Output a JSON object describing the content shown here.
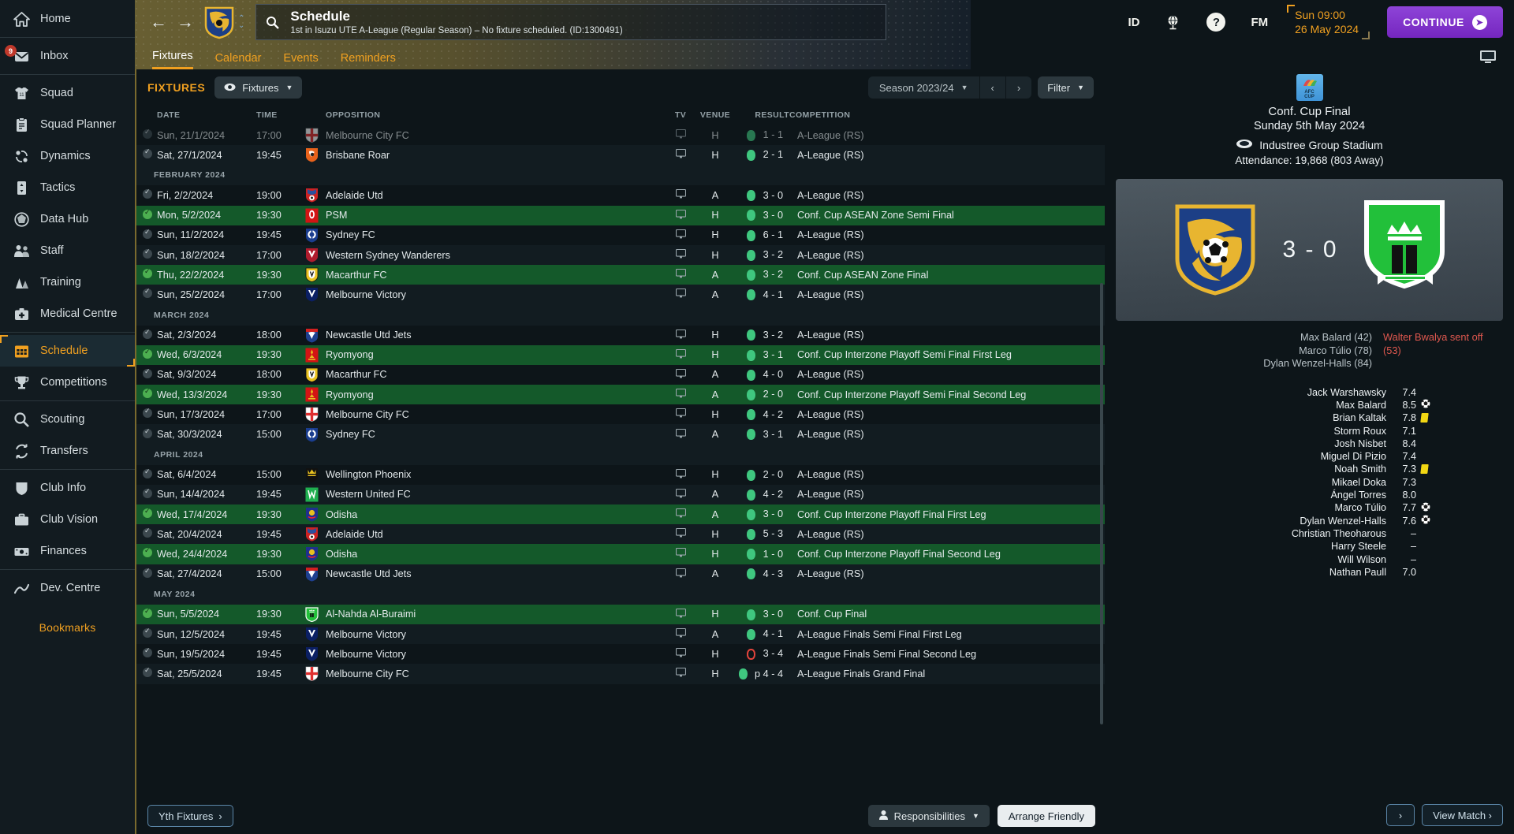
{
  "sidebar": {
    "items": [
      {
        "label": "Home",
        "icon": "home-icon"
      },
      {
        "label": "Inbox",
        "icon": "inbox-icon",
        "badge": "9"
      },
      {
        "label": "Squad",
        "icon": "shirt-icon"
      },
      {
        "label": "Squad Planner",
        "icon": "clipboard-icon"
      },
      {
        "label": "Dynamics",
        "icon": "dynamics-icon"
      },
      {
        "label": "Tactics",
        "icon": "tactics-icon"
      },
      {
        "label": "Data Hub",
        "icon": "data-hub-icon"
      },
      {
        "label": "Staff",
        "icon": "staff-icon"
      },
      {
        "label": "Training",
        "icon": "training-icon"
      },
      {
        "label": "Medical Centre",
        "icon": "medical-icon"
      },
      {
        "label": "Schedule",
        "icon": "calendar-icon",
        "active": true
      },
      {
        "label": "Competitions",
        "icon": "trophy-icon"
      },
      {
        "label": "Scouting",
        "icon": "magnifier-icon"
      },
      {
        "label": "Transfers",
        "icon": "transfer-icon"
      },
      {
        "label": "Club Info",
        "icon": "shield-icon"
      },
      {
        "label": "Club Vision",
        "icon": "briefcase-icon"
      },
      {
        "label": "Finances",
        "icon": "money-icon"
      },
      {
        "label": "Dev. Centre",
        "icon": "dev-centre-icon"
      }
    ],
    "bookmarks_label": "Bookmarks"
  },
  "header": {
    "title": "Schedule",
    "subtitle": "1st in Isuzu UTE A-League (Regular Season) – No fixture scheduled. (ID:1300491)",
    "back_icon": "back-arrow-icon",
    "forward_icon": "forward-arrow-icon",
    "search_icon": "search-icon",
    "icons": [
      "ID",
      "globe-icon",
      "help-icon",
      "FM"
    ],
    "game_time": "Sun 09:00",
    "game_date": "26 May 2024",
    "continue_label": "CONTINUE",
    "tabs": [
      {
        "label": "Fixtures",
        "selected": true
      },
      {
        "label": "Calendar",
        "selected": false
      },
      {
        "label": "Events",
        "selected": false
      },
      {
        "label": "Reminders",
        "selected": false
      }
    ]
  },
  "toolbar": {
    "section_title": "FIXTURES",
    "view_pill": "Fixtures",
    "season": "Season 2023/24",
    "prev": "‹",
    "next": "›",
    "filter": "Filter"
  },
  "table": {
    "columns": [
      "DATE",
      "TIME",
      "OPPOSITION",
      "TV",
      "VENUE",
      "RESULT",
      "COMPETITION"
    ],
    "rows": [
      {
        "type": "fixture",
        "partial": true,
        "checked": true,
        "date": "Sun, 21/1/2024",
        "time": "17:00",
        "opponent": "Melbourne City FC",
        "crest": "mcity",
        "tv": true,
        "venue": "H",
        "result": "1 - 1",
        "outcome": "w",
        "competition": "A-League (RS)",
        "highlight": false
      },
      {
        "type": "fixture",
        "checked": true,
        "date": "Sat, 27/1/2024",
        "time": "19:45",
        "opponent": "Brisbane Roar",
        "crest": "brisbane",
        "tv": true,
        "venue": "H",
        "result": "2 - 1",
        "outcome": "w",
        "competition": "A-League (RS)",
        "highlight": false
      },
      {
        "type": "month",
        "label": "FEBRUARY 2024"
      },
      {
        "type": "fixture",
        "checked": true,
        "date": "Fri, 2/2/2024",
        "time": "19:00",
        "opponent": "Adelaide Utd",
        "crest": "adelaide",
        "tv": true,
        "venue": "A",
        "result": "3 - 0",
        "outcome": "w",
        "competition": "A-League (RS)",
        "highlight": false
      },
      {
        "type": "fixture",
        "checked": true,
        "date": "Mon, 5/2/2024",
        "time": "19:30",
        "opponent": "PSM",
        "crest": "psm",
        "tv": true,
        "venue": "H",
        "result": "3 - 0",
        "outcome": "w",
        "competition": "Conf. Cup ASEAN Zone Semi Final",
        "highlight": true
      },
      {
        "type": "fixture",
        "checked": true,
        "date": "Sun, 11/2/2024",
        "time": "19:45",
        "opponent": "Sydney FC",
        "crest": "sydney",
        "tv": true,
        "venue": "H",
        "result": "6 - 1",
        "outcome": "w",
        "competition": "A-League (RS)",
        "highlight": false
      },
      {
        "type": "fixture",
        "checked": true,
        "date": "Sun, 18/2/2024",
        "time": "17:00",
        "opponent": "Western Sydney Wanderers",
        "crest": "wsw",
        "tv": true,
        "venue": "H",
        "result": "3 - 2",
        "outcome": "w",
        "competition": "A-League (RS)",
        "highlight": false
      },
      {
        "type": "fixture",
        "checked": true,
        "date": "Thu, 22/2/2024",
        "time": "19:30",
        "opponent": "Macarthur FC",
        "crest": "macarthur",
        "tv": true,
        "venue": "A",
        "result": "3 - 2",
        "outcome": "w",
        "competition": "Conf. Cup ASEAN Zone Final",
        "highlight": true
      },
      {
        "type": "fixture",
        "checked": true,
        "date": "Sun, 25/2/2024",
        "time": "17:00",
        "opponent": "Melbourne Victory",
        "crest": "mvictory",
        "tv": true,
        "venue": "A",
        "result": "4 - 1",
        "outcome": "w",
        "competition": "A-League (RS)",
        "highlight": false
      },
      {
        "type": "month",
        "label": "MARCH 2024"
      },
      {
        "type": "fixture",
        "checked": true,
        "date": "Sat, 2/3/2024",
        "time": "18:00",
        "opponent": "Newcastle Utd Jets",
        "crest": "newcastle",
        "tv": true,
        "venue": "H",
        "result": "3 - 2",
        "outcome": "w",
        "competition": "A-League (RS)",
        "highlight": false
      },
      {
        "type": "fixture",
        "checked": true,
        "date": "Wed, 6/3/2024",
        "time": "19:30",
        "opponent": "Ryomyong",
        "crest": "ryomyong",
        "tv": true,
        "venue": "H",
        "result": "3 - 1",
        "outcome": "w",
        "competition": "Conf. Cup Interzone Playoff Semi Final First Leg",
        "highlight": true
      },
      {
        "type": "fixture",
        "checked": true,
        "date": "Sat, 9/3/2024",
        "time": "18:00",
        "opponent": "Macarthur FC",
        "crest": "macarthur",
        "tv": true,
        "venue": "A",
        "result": "4 - 0",
        "outcome": "w",
        "competition": "A-League (RS)",
        "highlight": false
      },
      {
        "type": "fixture",
        "checked": true,
        "date": "Wed, 13/3/2024",
        "time": "19:30",
        "opponent": "Ryomyong",
        "crest": "ryomyong",
        "tv": true,
        "venue": "A",
        "result": "2 - 0",
        "outcome": "w",
        "competition": "Conf. Cup Interzone Playoff Semi Final Second Leg",
        "highlight": true
      },
      {
        "type": "fixture",
        "checked": true,
        "date": "Sun, 17/3/2024",
        "time": "17:00",
        "opponent": "Melbourne City FC",
        "crest": "mcity",
        "tv": true,
        "venue": "H",
        "result": "4 - 2",
        "outcome": "w",
        "competition": "A-League (RS)",
        "highlight": false
      },
      {
        "type": "fixture",
        "checked": true,
        "date": "Sat, 30/3/2024",
        "time": "15:00",
        "opponent": "Sydney FC",
        "crest": "sydney",
        "tv": true,
        "venue": "A",
        "result": "3 - 1",
        "outcome": "w",
        "competition": "A-League (RS)",
        "highlight": false
      },
      {
        "type": "month",
        "label": "APRIL 2024"
      },
      {
        "type": "fixture",
        "checked": true,
        "date": "Sat, 6/4/2024",
        "time": "15:00",
        "opponent": "Wellington Phoenix",
        "crest": "wellington",
        "tv": true,
        "venue": "H",
        "result": "2 - 0",
        "outcome": "w",
        "competition": "A-League (RS)",
        "highlight": false
      },
      {
        "type": "fixture",
        "checked": true,
        "date": "Sun, 14/4/2024",
        "time": "19:45",
        "opponent": "Western United FC",
        "crest": "westernutd",
        "tv": true,
        "venue": "A",
        "result": "4 - 2",
        "outcome": "w",
        "competition": "A-League (RS)",
        "highlight": false
      },
      {
        "type": "fixture",
        "checked": true,
        "date": "Wed, 17/4/2024",
        "time": "19:30",
        "opponent": "Odisha",
        "crest": "odisha",
        "tv": true,
        "venue": "A",
        "result": "3 - 0",
        "outcome": "w",
        "competition": "Conf. Cup Interzone Playoff Final First Leg",
        "highlight": true
      },
      {
        "type": "fixture",
        "checked": true,
        "date": "Sat, 20/4/2024",
        "time": "19:45",
        "opponent": "Adelaide Utd",
        "crest": "adelaide",
        "tv": true,
        "venue": "H",
        "result": "5 - 3",
        "outcome": "w",
        "competition": "A-League (RS)",
        "highlight": false
      },
      {
        "type": "fixture",
        "checked": true,
        "date": "Wed, 24/4/2024",
        "time": "19:30",
        "opponent": "Odisha",
        "crest": "odisha",
        "tv": true,
        "venue": "H",
        "result": "1 - 0",
        "outcome": "w",
        "competition": "Conf. Cup Interzone Playoff Final Second Leg",
        "highlight": true
      },
      {
        "type": "fixture",
        "checked": true,
        "date": "Sat, 27/4/2024",
        "time": "15:00",
        "opponent": "Newcastle Utd Jets",
        "crest": "newcastle",
        "tv": true,
        "venue": "A",
        "result": "4 - 3",
        "outcome": "w",
        "competition": "A-League (RS)",
        "highlight": false
      },
      {
        "type": "month",
        "label": "MAY 2024"
      },
      {
        "type": "fixture",
        "checked": true,
        "date": "Sun, 5/5/2024",
        "time": "19:30",
        "opponent": "Al-Nahda Al-Buraimi",
        "crest": "alnahda",
        "tv": true,
        "venue": "H",
        "result": "3 - 0",
        "outcome": "w",
        "competition": "Conf. Cup Final",
        "highlight": true,
        "selected": true
      },
      {
        "type": "fixture",
        "checked": true,
        "date": "Sun, 12/5/2024",
        "time": "19:45",
        "opponent": "Melbourne Victory",
        "crest": "mvictory",
        "tv": true,
        "venue": "A",
        "result": "4 - 1",
        "outcome": "w",
        "competition": "A-League Finals Semi Final First Leg",
        "highlight": false
      },
      {
        "type": "fixture",
        "checked": true,
        "date": "Sun, 19/5/2024",
        "time": "19:45",
        "opponent": "Melbourne Victory",
        "crest": "mvictory",
        "tv": true,
        "venue": "H",
        "result": "3 - 4",
        "outcome": "l",
        "competition": "A-League Finals Semi Final Second Leg",
        "highlight": false
      },
      {
        "type": "fixture",
        "checked": true,
        "date": "Sat, 25/5/2024",
        "time": "19:45",
        "opponent": "Melbourne City FC",
        "crest": "mcity",
        "tv": true,
        "venue": "H",
        "result": "p 4 - 4",
        "outcome": "w",
        "competition": "A-League Finals Grand Final",
        "highlight": false
      }
    ]
  },
  "bottom_bar": {
    "youth_fixtures": "Yth Fixtures",
    "responsibilities": "Responsibilities",
    "arrange_friendly": "Arrange Friendly"
  },
  "match_panel": {
    "competition_logo_line1": "AFC",
    "competition_logo_line2": "CUP",
    "competition": "Conf. Cup Final",
    "date": "Sunday 5th May 2024",
    "stadium": "Industree Group Stadium",
    "attendance": "Attendance: 19,868 (803 Away)",
    "score": "3 - 0",
    "home_team": "Central Coast Mariners",
    "away_team": "Al-Nahda Al-Buraimi",
    "scorers": [
      "Max Balard (42)",
      "Marco Túlio (78)",
      "Dylan Wenzel-Halls (84)"
    ],
    "events": [
      "Walter Bwalya sent off (53)"
    ],
    "ratings": [
      {
        "name": "Jack Warshawsky",
        "rating": "7.4",
        "icon": ""
      },
      {
        "name": "Max Balard",
        "rating": "8.5",
        "icon": "goal"
      },
      {
        "name": "Brian Kaltak",
        "rating": "7.8",
        "icon": "yellow"
      },
      {
        "name": "Storm Roux",
        "rating": "7.1",
        "icon": ""
      },
      {
        "name": "Josh Nisbet",
        "rating": "8.4",
        "icon": ""
      },
      {
        "name": "Miguel Di Pizio",
        "rating": "7.4",
        "icon": ""
      },
      {
        "name": "Noah Smith",
        "rating": "7.3",
        "icon": "yellow"
      },
      {
        "name": "Mikael Doka",
        "rating": "7.3",
        "icon": ""
      },
      {
        "name": "Ángel Torres",
        "rating": "8.0",
        "icon": ""
      },
      {
        "name": "Marco Túlio",
        "rating": "7.7",
        "icon": "goal"
      },
      {
        "name": "Dylan Wenzel-Halls",
        "rating": "7.6",
        "icon": "goal"
      },
      {
        "name": "Christian Theoharous",
        "rating": "–",
        "icon": ""
      },
      {
        "name": "Harry Steele",
        "rating": "–",
        "icon": ""
      },
      {
        "name": "Will Wilson",
        "rating": "–",
        "icon": ""
      },
      {
        "name": "Nathan Paull",
        "rating": "7.0",
        "icon": ""
      }
    ],
    "next_label": "›",
    "view_match_label": "View Match ›"
  },
  "colors": {
    "accent": "#f0a020",
    "continue": "#7526bf",
    "win_green": "#3fc77f",
    "loss_red": "#e4443c",
    "row_highlight": "#14592a",
    "background": "#0d1519"
  }
}
